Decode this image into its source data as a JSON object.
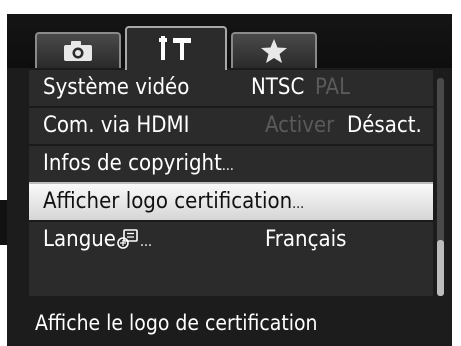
{
  "tabs": [
    {
      "name": "camera",
      "icon": "camera-icon",
      "selected": false
    },
    {
      "name": "setup",
      "icon": "tools-icon",
      "selected": true
    },
    {
      "name": "mymenu",
      "icon": "star-icon",
      "selected": false
    }
  ],
  "menu": {
    "items": [
      {
        "label": "Système vidéo",
        "options": [
          "NTSC",
          "PAL"
        ],
        "selected_option": "NTSC"
      },
      {
        "label": "Com. via HDMI",
        "options": [
          "Activer",
          "Désact."
        ],
        "selected_option": "Désact."
      },
      {
        "label": "Infos de copyright",
        "suffix": "..."
      },
      {
        "label": "Afficher logo certification",
        "suffix": "...",
        "highlighted": true
      },
      {
        "label": "Langue",
        "suffix": "...",
        "value": "Français"
      }
    ]
  },
  "hint": "Affiche le logo de certification",
  "colors": {
    "background": "#1c1c1c",
    "panel": "#2b2b2b",
    "highlight": "#e8e8e8",
    "text": "#ffffff",
    "dim_text": "#5a5a5a"
  }
}
